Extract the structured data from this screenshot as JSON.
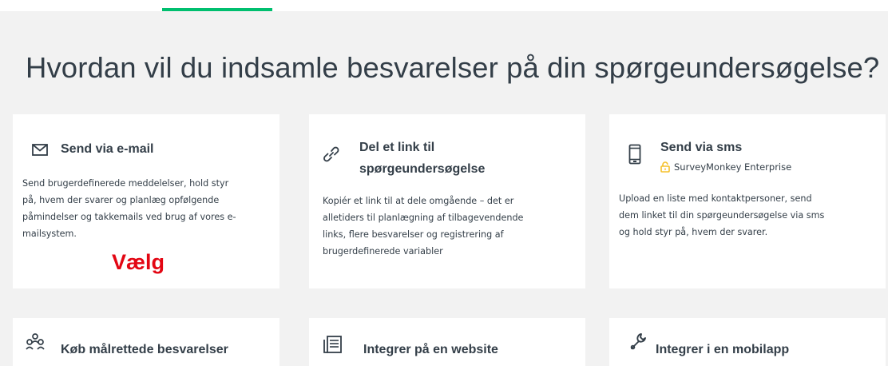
{
  "page": {
    "headline": "Hvordan vil du indsamle besvarelser på din spørgeundersøgelse?"
  },
  "cards": [
    {
      "icon": "envelope-icon",
      "title": "Send via e-mail",
      "description_lines": [
        "Send brugerdefinerede meddelelser, hold styr",
        "på, hvem der svarer og planlæg opfølgende",
        "påmindelser og takkemails ved brug af vores e-",
        "mailsystem."
      ],
      "action_label": "Vælg"
    },
    {
      "icon": "link-icon",
      "title_lines": [
        "Del et link til",
        "spørgeundersøgelse"
      ],
      "description_lines": [
        "Kopiér et link til at dele omgående – det er",
        "alletiders til planlægning af tilbagevendende",
        "links, flere besvarelser og registrering af",
        "brugerdefinerede variabler"
      ]
    },
    {
      "icon": "mobile-phone-icon",
      "title": "Send via sms",
      "badge": {
        "icon": "lock-icon",
        "label": "SurveyMonkey Enterprise",
        "color": "#f5c02a"
      },
      "description_lines": [
        "Upload en liste med kontaktpersoner, send",
        "dem linket til din spørgeundersøgelse via sms",
        "og hold styr på, hvem der svarer."
      ]
    },
    {
      "icon": "audience-icon",
      "title": "Køb målrettede besvarelser"
    },
    {
      "icon": "website-embed-icon",
      "title": "Integrer på en website"
    },
    {
      "icon": "wrench-icon",
      "title": "Integrer i en mobilapp"
    }
  ],
  "colors": {
    "background": "#f2f2f2",
    "card": "#ffffff",
    "accent": "#00bf6f",
    "text": "#333e48",
    "annotation": "#e30613",
    "enterprise_lock": "#f5c02a"
  }
}
